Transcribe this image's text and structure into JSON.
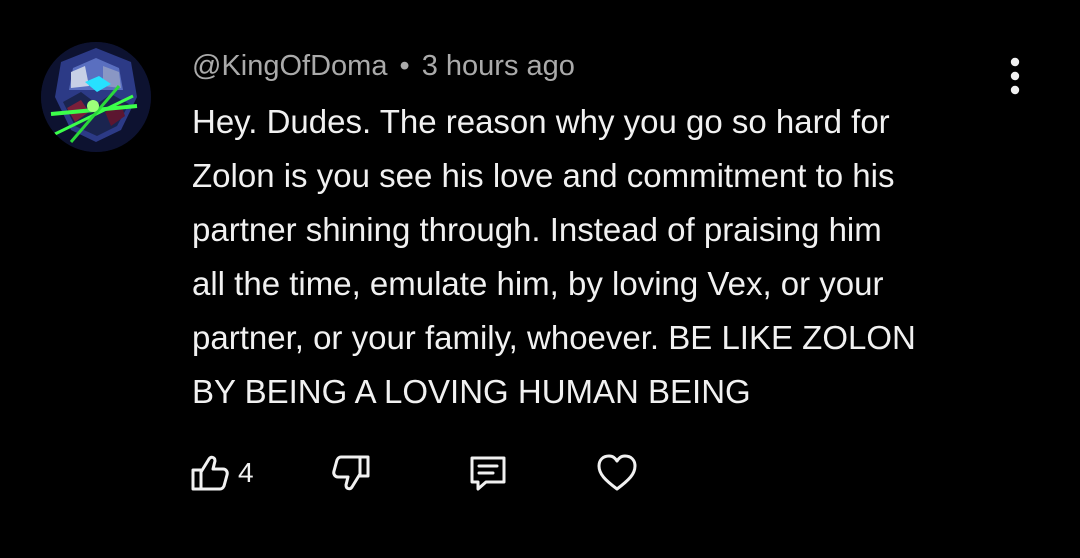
{
  "comment": {
    "author": "@KingOfDoma",
    "separator": "•",
    "timestamp": "3 hours ago",
    "text": "Hey. Dudes. The reason why you go so hard for\nZolon is you see his love and commitment to his\npartner shining through. Instead of praising him\nall the time, emulate him, by loving Vex, or your\npartner, or your family, whoever. BE LIKE ZOLON\nBY BEING A LOVING HUMAN BEING",
    "like_count": "4"
  },
  "icons": {
    "more": "more-vert-icon",
    "like": "thumbs-up-icon",
    "dislike": "thumbs-down-icon",
    "reply": "comment-icon",
    "heart": "heart-icon"
  },
  "colors": {
    "background": "#000000",
    "text": "#f1f1f1",
    "meta": "#aaaaaa"
  }
}
